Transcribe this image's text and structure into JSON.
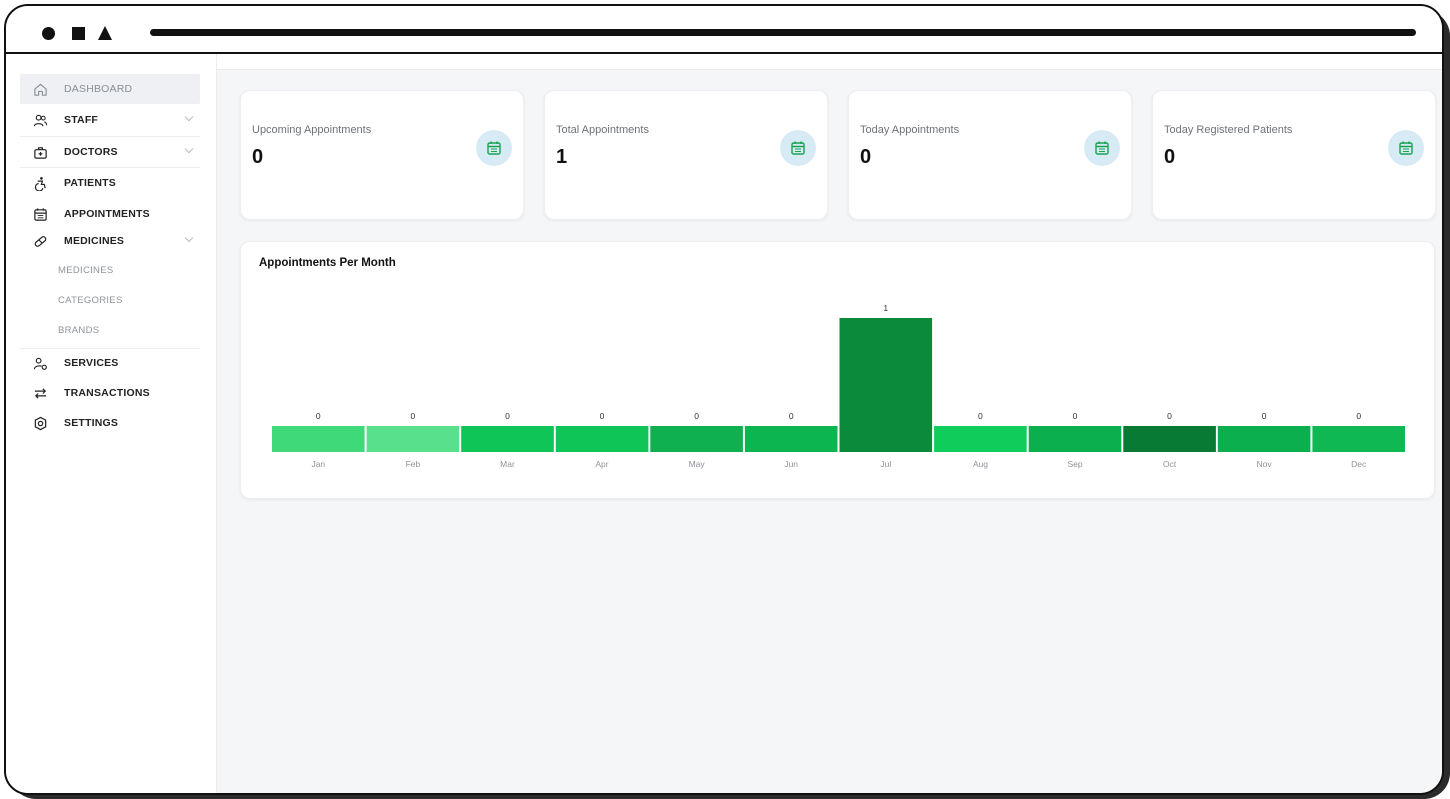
{
  "sidebar": {
    "items": [
      {
        "label": "DASHBOARD",
        "icon": "home-icon",
        "active": true
      },
      {
        "label": "STAFF",
        "icon": "users-icon",
        "chevron": true
      },
      {
        "label": "DOCTORS",
        "icon": "doctor-bag-icon",
        "chevron": true
      },
      {
        "label": "PATIENTS",
        "icon": "accessibility-icon"
      },
      {
        "label": "APPOINTMENTS",
        "icon": "calendar-icon"
      },
      {
        "label": "MEDICINES",
        "icon": "pill-icon",
        "chevron": true
      },
      {
        "label": "SERVICES",
        "icon": "service-icon"
      },
      {
        "label": "TRANSACTIONS",
        "icon": "transfer-icon"
      },
      {
        "label": "SETTINGS",
        "icon": "gear-icon"
      }
    ],
    "medicines_sub": [
      "MEDICINES",
      "CATEGORIES",
      "BRANDS"
    ]
  },
  "cards": [
    {
      "label": "Upcoming Appointments",
      "value": "0"
    },
    {
      "label": "Total Appointments",
      "value": "1"
    },
    {
      "label": "Today Appointments",
      "value": "0"
    },
    {
      "label": "Today Registered Patients",
      "value": "0"
    }
  ],
  "colors": {
    "accent": "#0a8a3a",
    "icon_bg": "#d7ebf5",
    "icon_fg": "#1aa351"
  },
  "chart_data": {
    "type": "bar",
    "title": "Appointments Per Month",
    "categories": [
      "Jan",
      "Feb",
      "Mar",
      "Apr",
      "May",
      "Jun",
      "Jul",
      "Aug",
      "Sep",
      "Oct",
      "Nov",
      "Dec"
    ],
    "values": [
      0,
      0,
      0,
      0,
      0,
      0,
      1,
      0,
      0,
      0,
      0,
      0
    ],
    "bar_colors": [
      "#3fd97a",
      "#58e08c",
      "#10c558",
      "#10c558",
      "#0fb04f",
      "#0db551",
      "#0a8a3a",
      "#10cc5b",
      "#0caf4e",
      "#087a33",
      "#0caf4e",
      "#10b853"
    ],
    "ylim": [
      0,
      1
    ],
    "grid": false,
    "legend": "none"
  }
}
